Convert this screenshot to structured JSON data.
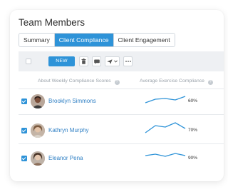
{
  "title": "Team Members",
  "tabs": [
    {
      "label": "Summary",
      "active": false
    },
    {
      "label": "Client Compliance",
      "active": true
    },
    {
      "label": "Client Engagement",
      "active": false
    }
  ],
  "toolbar": {
    "new_label": "NEW",
    "icons": [
      "trash-icon",
      "comment-icon",
      "send-dropdown-icon",
      "more-icon"
    ]
  },
  "columns": {
    "weekly": "About Weekly Compliance Scores",
    "exercise": "Average Exercise Compliance"
  },
  "rows": [
    {
      "name": "Brooklyn Simmons",
      "percent": "60%",
      "checked": true
    },
    {
      "name": "Kathryn Murphy",
      "percent": "70%",
      "checked": true
    },
    {
      "name": "Eleanor Pena",
      "percent": "90%",
      "checked": true
    }
  ],
  "colors": {
    "accent": "#2e93d8",
    "link": "#2e7fc4",
    "sparkline": "#2e93d8"
  }
}
